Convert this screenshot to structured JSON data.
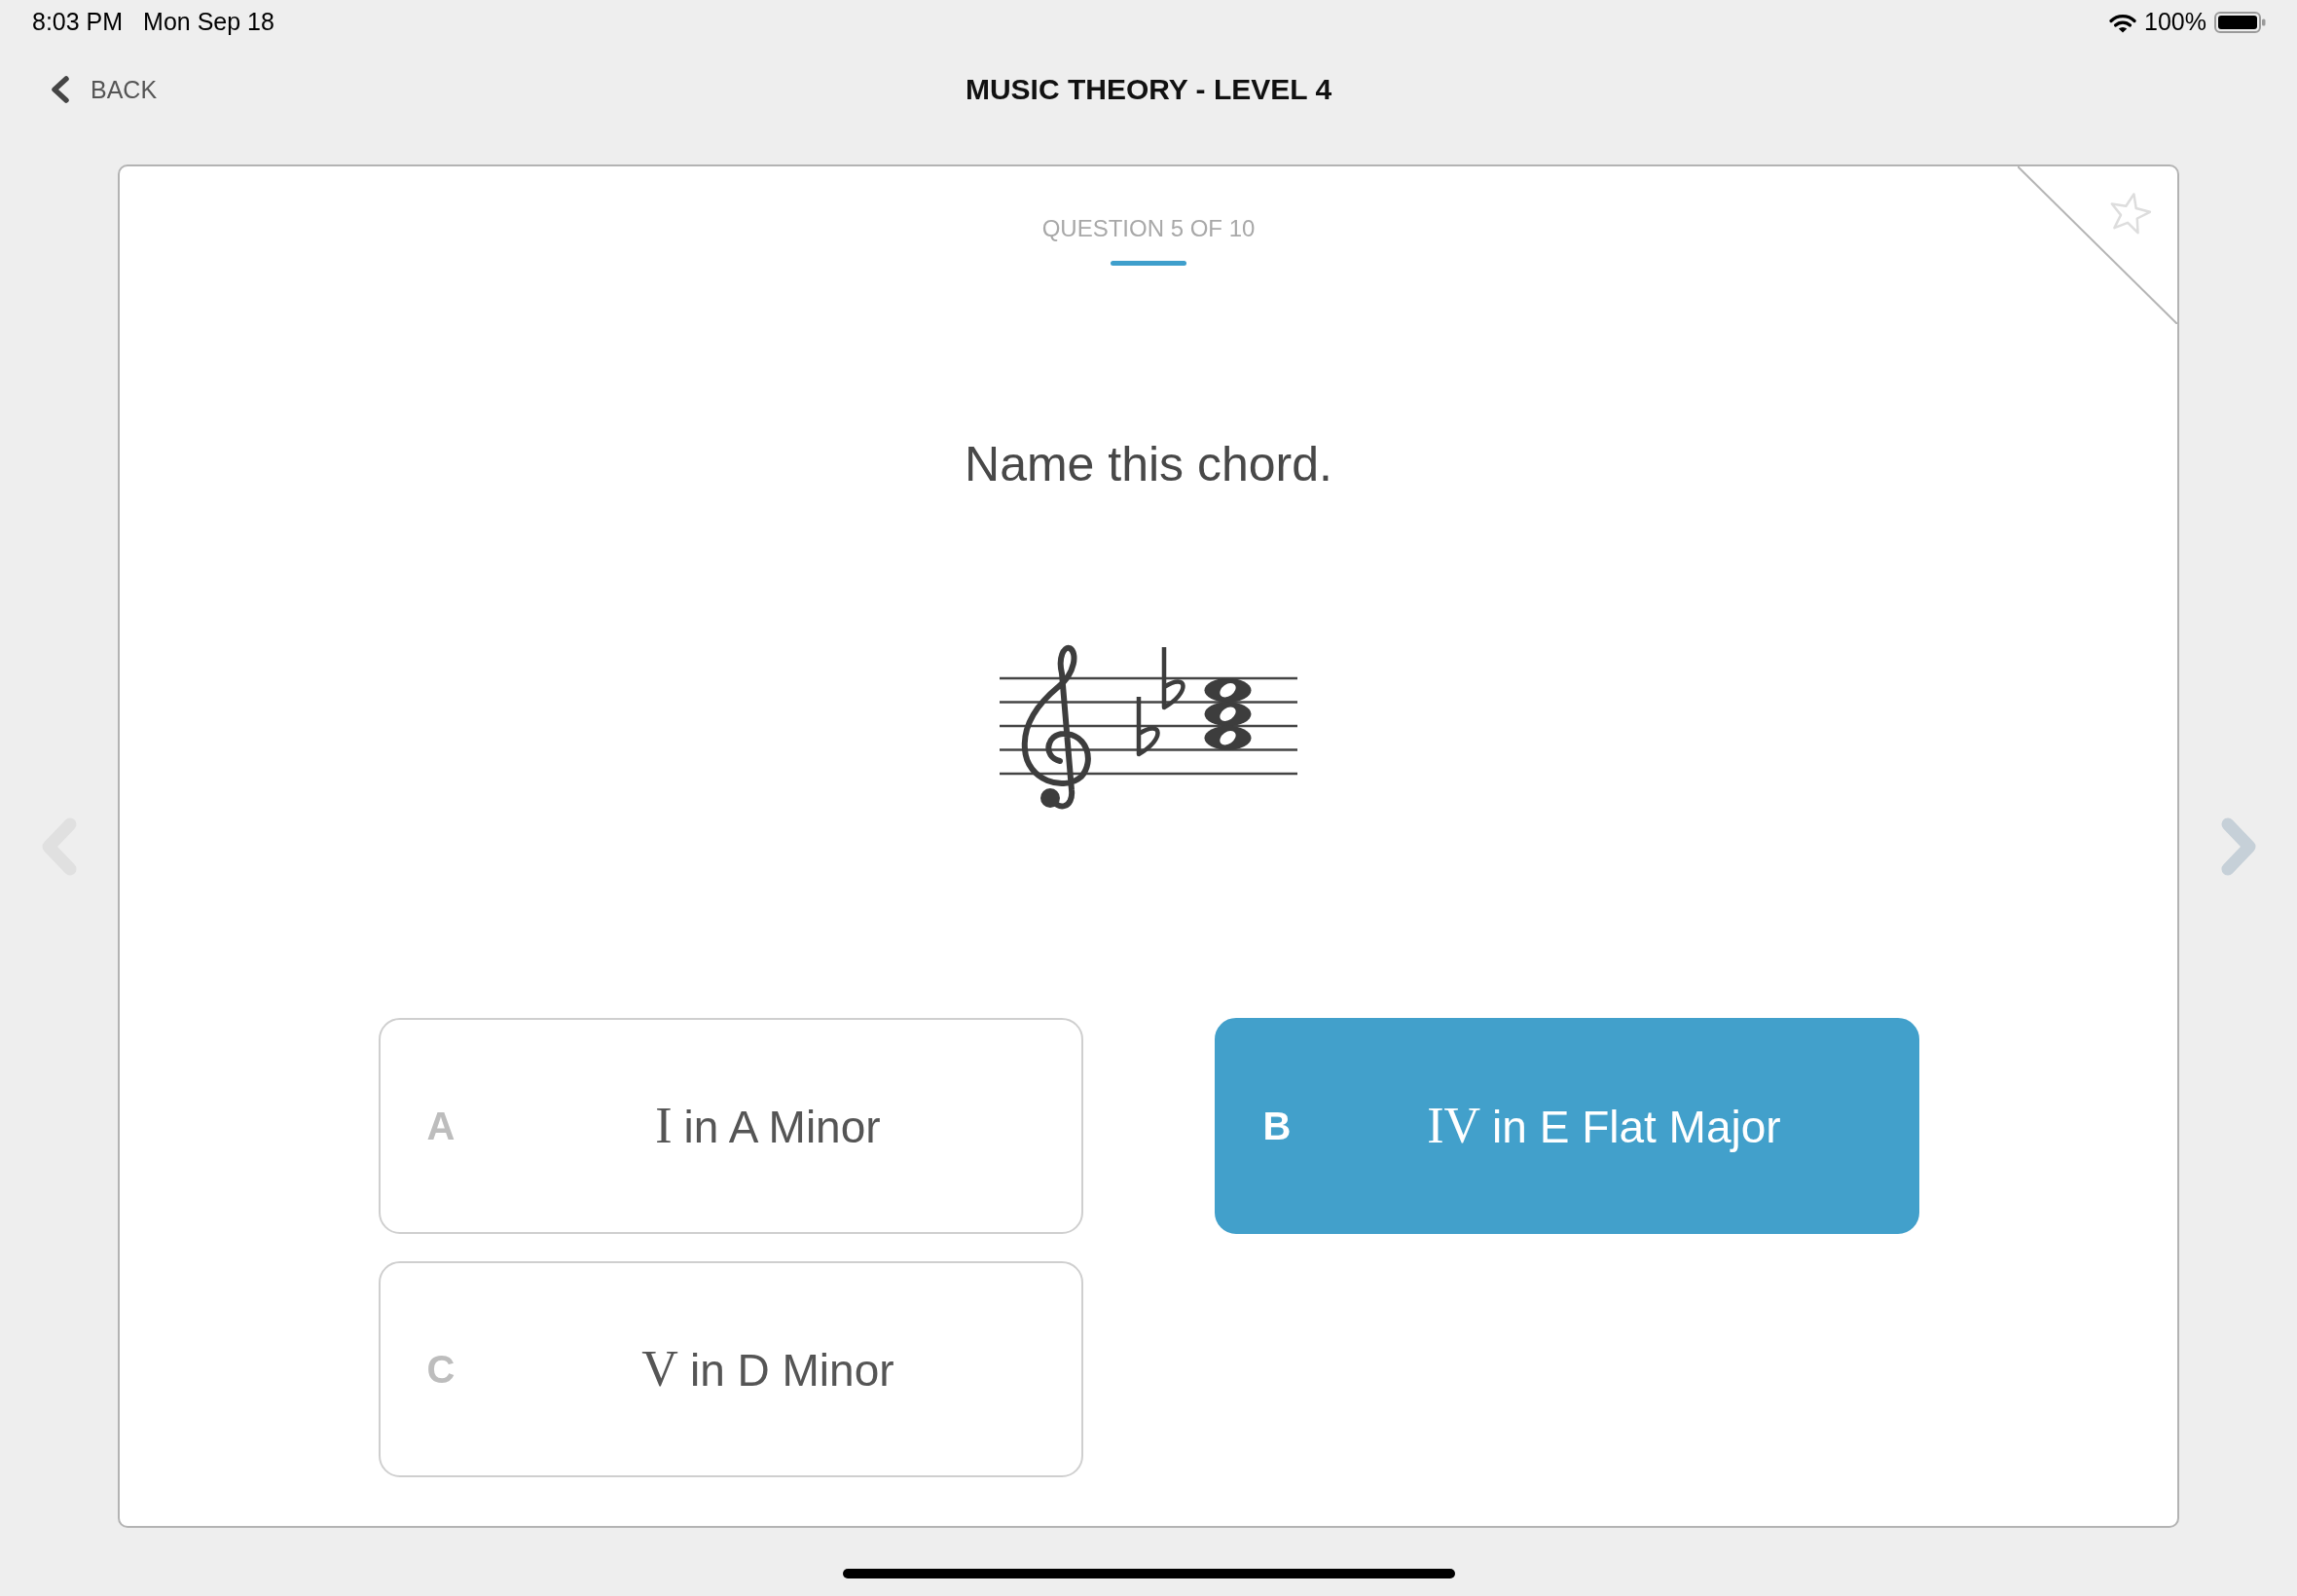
{
  "status_bar": {
    "time": "8:03 PM",
    "date": "Mon Sep 18",
    "battery": "100%"
  },
  "header": {
    "back": "BACK",
    "title": "MUSIC THEORY - LEVEL 4"
  },
  "question": {
    "progress": "QUESTION 5 OF 10",
    "starred": false,
    "prompt": "Name this chord."
  },
  "answers": [
    {
      "letter": "A",
      "numeral": "I",
      "label": "in A Minor",
      "selected": false
    },
    {
      "letter": "B",
      "numeral": "IV",
      "label": "in E Flat Major",
      "selected": true
    },
    {
      "letter": "C",
      "numeral": "V",
      "label": "in D Minor",
      "selected": false
    }
  ],
  "nav_arrows": [
    {
      "kind": "previous",
      "disabled": true
    },
    {
      "kind": "next",
      "disabled": false
    }
  ]
}
